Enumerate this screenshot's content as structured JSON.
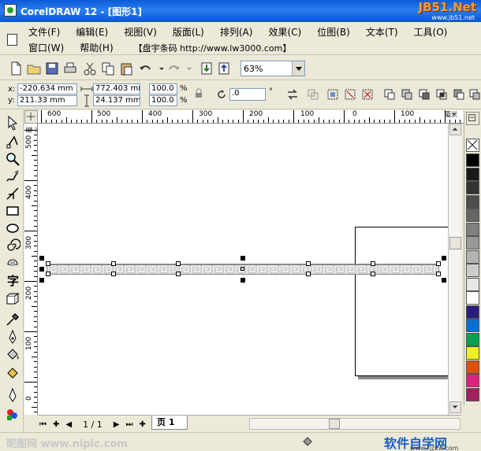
{
  "window": {
    "title": "CorelDRAW 12 - [图形1]",
    "watermark_top": "JB51.Net",
    "watermark_top_sub": "www.jb51.net"
  },
  "menu": {
    "row1": [
      "文件(F)",
      "编辑(E)",
      "视图(V)",
      "版面(L)",
      "排列(A)",
      "效果(C)",
      "位图(B)",
      "文本(T)",
      "工具(O)"
    ],
    "row2": [
      "窗口(W)",
      "帮助(H)"
    ],
    "tagline": "【盘宇条码 http://www.lw3000.com】"
  },
  "toolbar": {
    "zoom_value": "63%"
  },
  "property_bar": {
    "x_label": "x:",
    "x_value": "-220.634 mm",
    "y_label": "y:",
    "y_value": "211.33 mm",
    "width_value": "772.403 mr",
    "height_value": "24.137 mm",
    "scale_x": "100.0",
    "scale_y": "100.0",
    "percent": "%",
    "rotation_value": ".0",
    "degree": "°"
  },
  "rulers": {
    "h_labels": [
      "600",
      "500",
      "400",
      "300",
      "200",
      "100",
      "0",
      "100"
    ],
    "h_unit": "毫米",
    "v_labels": [
      "500",
      "400",
      "300",
      "200",
      "100",
      "0"
    ],
    "v_unit": "毫米"
  },
  "bottom": {
    "page_count": "1 / 1",
    "page_tab": "页 1"
  },
  "status": {
    "watermark_left": "昵图网 www.nipic.com",
    "watermark_right": "软件自学网",
    "watermark_right_sub": "www.rjzxw.com"
  },
  "colors": {
    "titlebar": "#0a5bd6",
    "palette": [
      "#000000",
      "#1a1a1a",
      "#333333",
      "#4d4d4d",
      "#666666",
      "#808080",
      "#999999",
      "#b3b3b3",
      "#cccccc",
      "#e6e6e6",
      "#ffffff",
      "#2b1c7a",
      "#0070d0",
      "#00a050",
      "#f0f020",
      "#e05010",
      "#e02080",
      "#a02060"
    ]
  }
}
